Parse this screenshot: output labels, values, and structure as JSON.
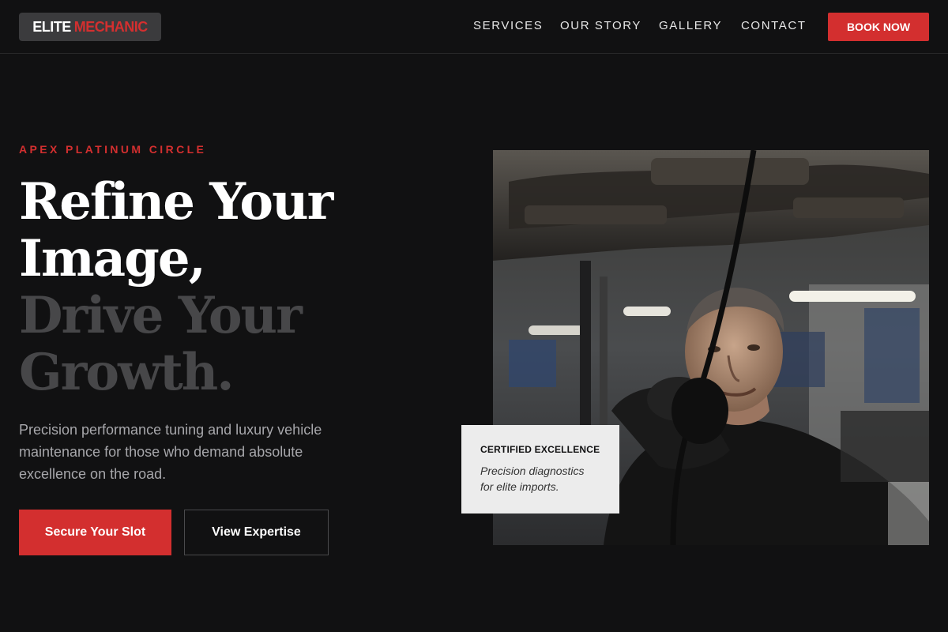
{
  "brand": {
    "word1": "ELITE",
    "word2": "MECHANIC",
    "accent_color": "#d32f2f"
  },
  "nav": {
    "items": [
      "SERVICES",
      "OUR STORY",
      "GALLERY",
      "CONTACT"
    ],
    "cta_label": "BOOK NOW"
  },
  "hero": {
    "eyebrow": "APEX PLATINUM CIRCLE",
    "headline": [
      "Refine Your",
      "Image,",
      "Drive Your",
      "Growth."
    ],
    "description": "Precision performance tuning and luxury vehicle maintenance for those who demand absolute excellence on the road.",
    "primary_button": "Secure Your Slot",
    "secondary_button": "View Expertise"
  },
  "image": {
    "subject": "mechanic-working-under-car-photo"
  },
  "card": {
    "title": "CERTIFIED EXCELLENCE",
    "description": "Precision diagnostics for elite imports."
  }
}
